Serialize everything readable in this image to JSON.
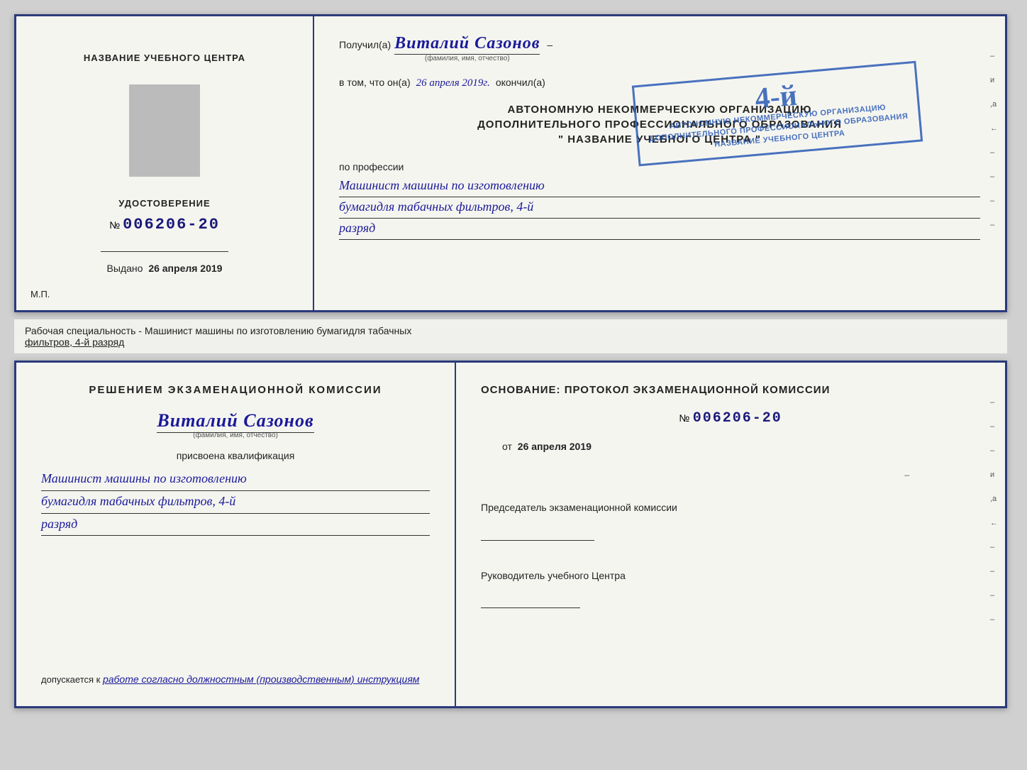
{
  "page": {
    "background_color": "#d0d0d0"
  },
  "top_cert": {
    "left": {
      "title": "НАЗВАНИЕ УЧЕБНОГО ЦЕНТРА",
      "udostoverenie_label": "УДОСТОВЕРЕНИЕ",
      "number_sign": "№",
      "number": "006206-20",
      "issued_label": "Выдано",
      "issued_date": "26 апреля 2019",
      "mp_label": "М.П."
    },
    "right": {
      "recipient_prefix": "Получил(а)",
      "recipient_name": "Виталий Сазонов",
      "recipient_dash": "–",
      "recipient_subtitle": "(фамилия, имя, отчество)",
      "certify_prefix": "в том, что он(а)",
      "certify_date": "26 апреля 2019г.",
      "completed_label": "окончил(а)",
      "org_line1": "АВТОНОМНУЮ НЕКОММЕРЧЕСКУЮ ОРГАНИЗАЦИЮ",
      "org_line2": "ДОПОЛНИТЕЛЬНОГО ПРОФЕССИОНАЛЬНОГО ОБРАЗОВАНИЯ",
      "org_name": "\" НАЗВАНИЕ УЧЕБНОГО ЦЕНТРА \"",
      "profession_label": "по профессии",
      "profession_line1": "Машинист машины по изготовлению",
      "profession_line2": "бумагидля табачных фильтров, 4-й",
      "profession_line3": "разряд",
      "stamp": {
        "number": "4-й",
        "line1": "АВТОНОМНУЮ НЕКОММЕРЧЕСКУЮ ОРГАНИЗАЦИЮ",
        "line2": "ДОПОЛНИТЕЛЬНОГО ПРОФЕССИОНАЛЬНОГО ОБРАЗОВАНИЯ",
        "line3": "НАЗВАНИЕ УЧЕБНОГО ЦЕНТРА"
      },
      "edge_marks": [
        "-",
        "и",
        ",а",
        "←",
        "-",
        "-",
        "-",
        "-"
      ]
    }
  },
  "info_bar": {
    "text": "Рабочая специальность - Машинист машины по изготовлению бумагидля табачных",
    "text_underline": "фильтров, 4-й разряд"
  },
  "bottom_cert": {
    "left": {
      "commission_title": "Решением экзаменационной комиссии",
      "person_name": "Виталий Сазонов",
      "person_subtitle": "(фамилия, имя, отчество)",
      "qualification_label": "присвоена квалификация",
      "qualification_line1": "Машинист машины по изготовлению",
      "qualification_line2": "бумагидля табачных фильтров, 4-й",
      "qualification_line3": "разряд",
      "allowed_label": "допускается к",
      "allowed_text": "работе согласно должностным (производственным) инструкциям"
    },
    "right": {
      "basis_label": "Основание: протокол экзаменационной комиссии",
      "basis_number_sign": "№",
      "basis_number": "006206-20",
      "basis_date_prefix": "от",
      "basis_date": "26 апреля 2019",
      "chairman_label": "Председатель экзаменационной комиссии",
      "head_label": "Руководитель учебного Центра",
      "edge_marks": [
        "-",
        "-",
        "-",
        "и",
        ",а",
        "←",
        "-",
        "-",
        "-",
        "-"
      ]
    }
  }
}
